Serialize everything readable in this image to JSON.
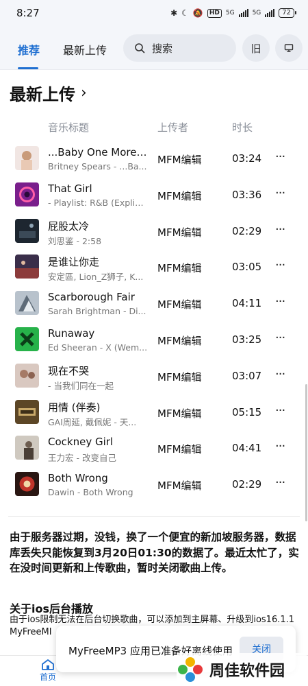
{
  "status": {
    "time": "8:27",
    "battery": "72",
    "hd": "HD",
    "net1": "5G",
    "net2": "5G"
  },
  "header": {
    "tabs": [
      {
        "label": "推荐"
      },
      {
        "label": "最新上传"
      }
    ],
    "search_label": "搜索",
    "legacy_label": "旧",
    "icons": {
      "search": "search-icon",
      "monitor": "monitor-icon"
    }
  },
  "section": {
    "title": "最新上传"
  },
  "columns": {
    "title": "音乐标题",
    "uploader": "上传者",
    "duration": "时长"
  },
  "songs": [
    {
      "title": "...Baby One More ...",
      "artist": "Britney Spears - ...Ba...",
      "uploader": "MFM编辑",
      "duration": "03:24",
      "more": "···",
      "cover_color": "#f1e6e3"
    },
    {
      "title": "That Girl",
      "artist": "- Playlist: R&B (Explicit)",
      "uploader": "MFM编辑",
      "duration": "03:36",
      "more": "···",
      "cover_color": "#7a1f8c"
    },
    {
      "title": "屁股太冷",
      "artist": "刘思鉴 - 2:58",
      "uploader": "MFM编辑",
      "duration": "02:29",
      "more": "···",
      "cover_color": "#1d2630"
    },
    {
      "title": "是谁让你走",
      "artist": "安定區, Lion_Z狮子, K...",
      "uploader": "MFM编辑",
      "duration": "03:05",
      "more": "···",
      "cover_color": "#3a2e4a"
    },
    {
      "title": "Scarborough Fair",
      "artist": "Sarah Brightman - Di...",
      "uploader": "MFM编辑",
      "duration": "04:11",
      "more": "···",
      "cover_color": "#b8c2cc"
    },
    {
      "title": "Runaway",
      "artist": "Ed Sheeran - X (Wem...",
      "uploader": "MFM编辑",
      "duration": "03:25",
      "more": "···",
      "cover_color": "#27b24a"
    },
    {
      "title": "现在不哭",
      "artist": "- 当我们同在一起",
      "uploader": "MFM编辑",
      "duration": "03:07",
      "more": "···",
      "cover_color": "#d9c8c0"
    },
    {
      "title": "用情 (伴奏)",
      "artist": "GAI周延, 戴佩妮 - 天...",
      "uploader": "MFM编辑",
      "duration": "05:15",
      "more": "···",
      "cover_color": "#5c4626"
    },
    {
      "title": "Cockney Girl",
      "artist": "王力宏 - 改变自己",
      "uploader": "MFM编辑",
      "duration": "04:41",
      "more": "···",
      "cover_color": "#cfc9c0"
    },
    {
      "title": "Both Wrong",
      "artist": "Dawin - Both Wrong",
      "uploader": "MFM编辑",
      "duration": "02:29",
      "more": "···",
      "cover_color": "#2a1612"
    }
  ],
  "notice": "由于服务器过期，没钱，换了一个便宜的新加坡服务器，数据库丢失只能恢复到3月20日01:30的数据了。最近太忙了，实在没时间更新和上传歌曲，暂时关闭歌曲上传。",
  "ios": {
    "heading": "关于ios后台播放",
    "body": "由于ios限制无法在后台切换歌曲，可以添加到主屏幕、升级到ios16.1.1",
    "body2": "MyFreeMI"
  },
  "bottom_nav": {
    "home_label": "首页"
  },
  "toast": {
    "message": "MyFreeMP3 应用已准备好离线使用",
    "close_label": "关闭"
  },
  "watermark": {
    "text": "周佳软件园"
  },
  "colors": {
    "accent": "#1f6fd1",
    "muted": "#8a8f99",
    "surface": "#e7eaf0"
  }
}
